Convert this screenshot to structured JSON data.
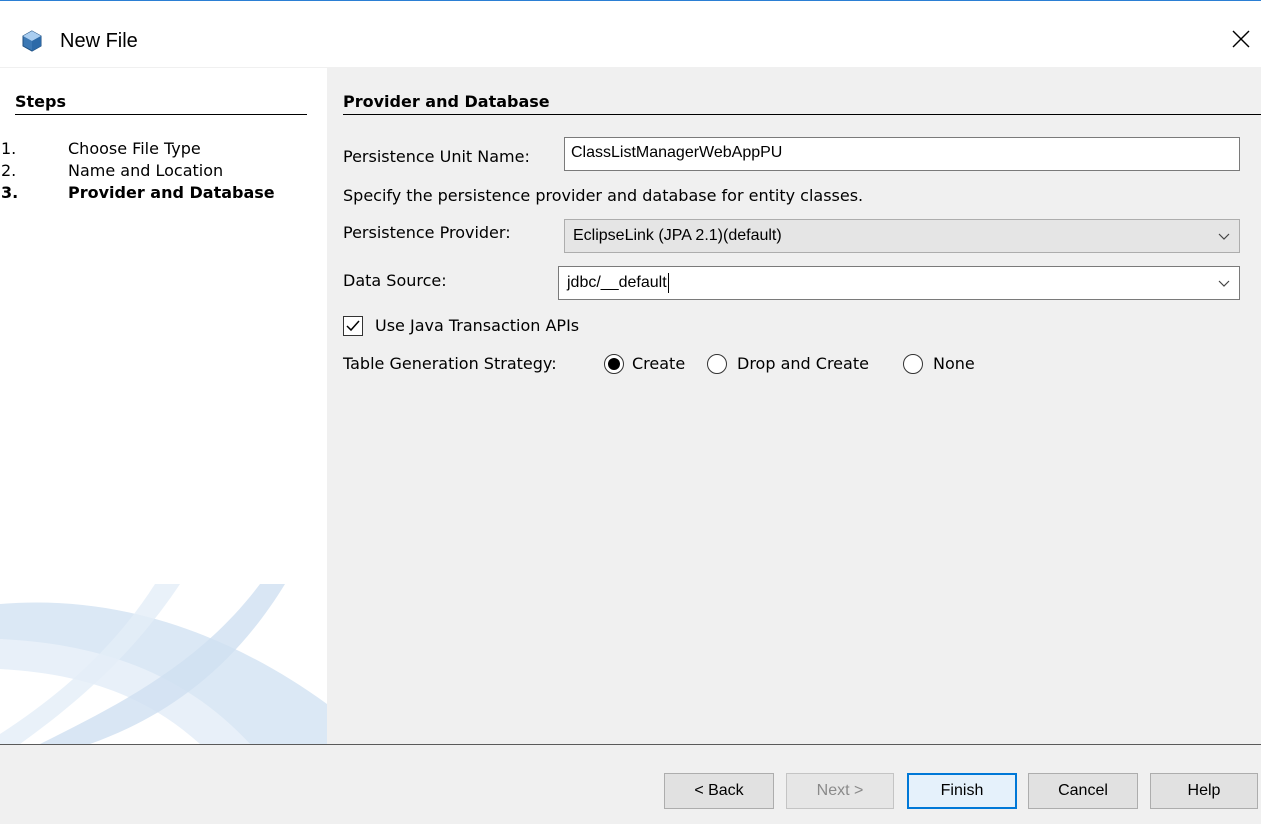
{
  "window": {
    "title": "New File"
  },
  "steps": {
    "header": "Steps",
    "items": [
      {
        "num": "1.",
        "label": "Choose File Type"
      },
      {
        "num": "2.",
        "label": "Name and Location"
      },
      {
        "num": "3.",
        "label": "Provider and Database"
      }
    ],
    "current_index": 2
  },
  "main": {
    "header": "Provider and Database",
    "persistence_unit_label": "Persistence Unit Name:",
    "persistence_unit_value": "ClassListManagerWebAppPU",
    "description": "Specify the persistence provider and database for entity classes.",
    "provider_label": "Persistence Provider:",
    "provider_value": "EclipseLink (JPA 2.1)(default)",
    "datasource_label": "Data Source:",
    "datasource_value": "jdbc/__default",
    "jta_label": "Use Java Transaction APIs",
    "jta_checked": true,
    "table_strategy_label": "Table Generation Strategy:",
    "table_strategy_options": [
      "Create",
      "Drop and Create",
      "None"
    ],
    "table_strategy_selected": "Create"
  },
  "buttons": {
    "back": "< Back",
    "next": "Next >",
    "finish": "Finish",
    "cancel": "Cancel",
    "help": "Help"
  },
  "icons": {
    "title": "cube-icon",
    "close": "close-icon",
    "dropdown": "chevron-down-icon",
    "check": "check-icon"
  },
  "colors": {
    "accent": "#0078d7",
    "title_icon": "#3c78b4"
  }
}
